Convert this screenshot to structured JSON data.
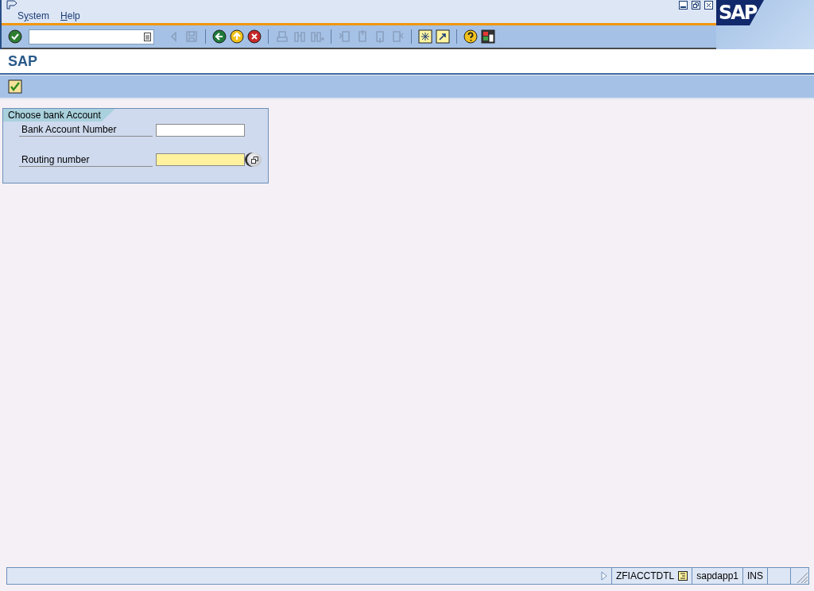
{
  "menu": [
    {
      "before": "S",
      "key": "y",
      "after": "stem"
    },
    {
      "key": "H",
      "after": "elp"
    }
  ],
  "logo": "SAP",
  "command_field": {
    "has_history": true
  },
  "screen_title": "SAP",
  "group": {
    "title": "Choose bank Account",
    "fields": [
      {
        "label": "Bank Account Number",
        "required": false,
        "has_help": false
      },
      {
        "label": "Routing number",
        "required": true,
        "has_help": true
      }
    ]
  },
  "status_bar": {
    "transaction": "ZFIACCTDTL",
    "server": "sapdapp1",
    "mode": "INS"
  }
}
